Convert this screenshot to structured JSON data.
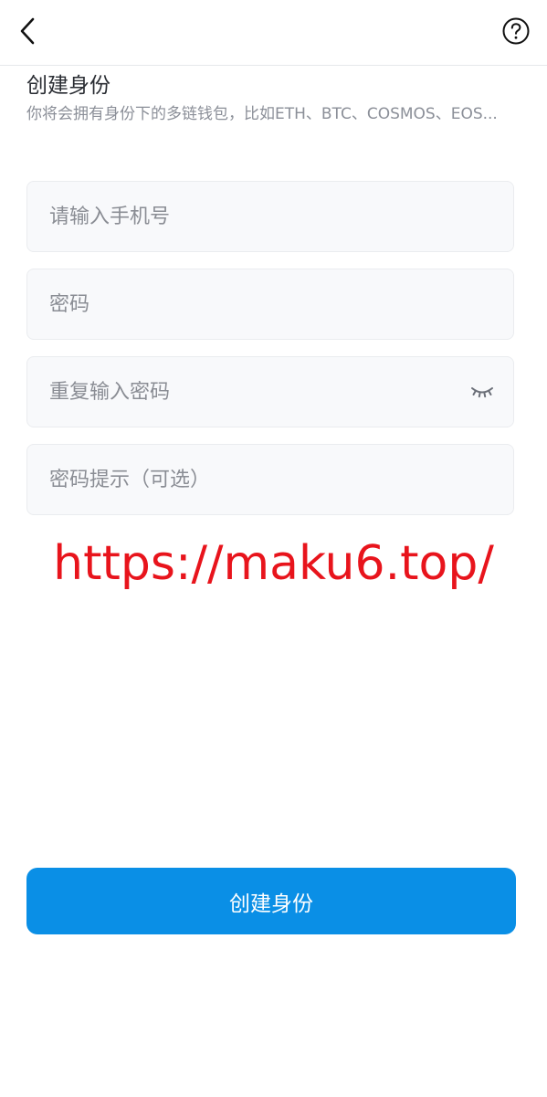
{
  "colors": {
    "primary": "#0a8fe6",
    "watermark": "#e8141c",
    "field_bg": "#f8f9fb"
  },
  "header": {
    "back_icon": "chevron-left-icon",
    "help_icon": "question-circle-icon"
  },
  "page": {
    "title": "创建身份",
    "subtitle": "你将会拥有身份下的多链钱包，比如ETH、BTC、COSMOS、EOS..."
  },
  "form": {
    "phone_placeholder": "请输入手机号",
    "password_placeholder": "密码",
    "confirm_password_placeholder": "重复输入密码",
    "password_hint_placeholder": "密码提示（可选）",
    "eye_icon": "eye-closed-icon"
  },
  "watermark": {
    "text": "https://maku6.top/"
  },
  "submit": {
    "label": "创建身份"
  }
}
